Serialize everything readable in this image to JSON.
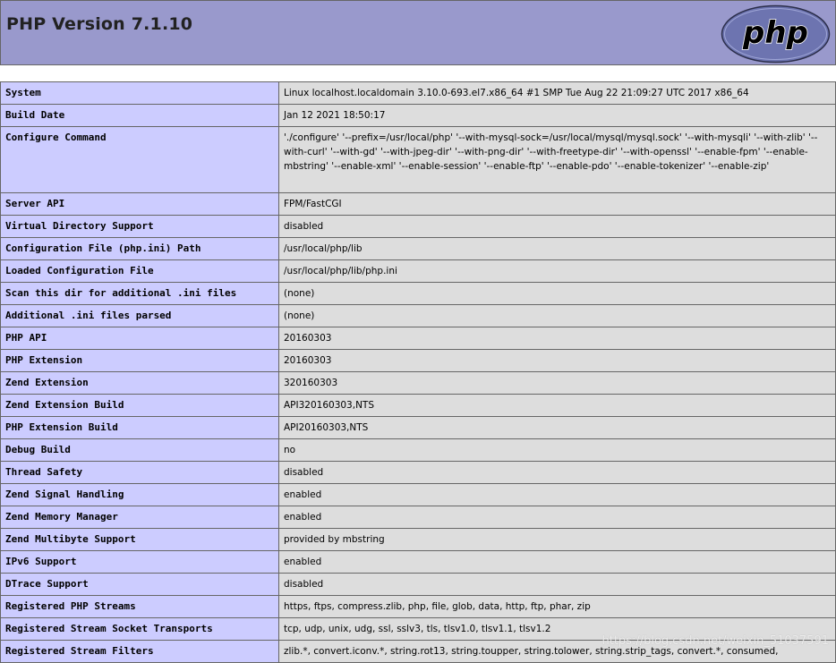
{
  "header": {
    "title": "PHP Version 7.1.10",
    "logo_text": "php"
  },
  "rows": [
    {
      "key": "System",
      "value": "Linux localhost.localdomain 3.10.0-693.el7.x86_64 #1 SMP Tue Aug 22 21:09:27 UTC 2017 x86_64"
    },
    {
      "key": "Build Date",
      "value": "Jan 12 2021 18:50:17"
    },
    {
      "key": "Configure Command",
      "value": "'./configure' '--prefix=/usr/local/php' '--with-mysql-sock=/usr/local/mysql/mysql.sock' '--with-mysqli' '--with-zlib' '--with-curl' '--with-gd' '--with-jpeg-dir' '--with-png-dir' '--with-freetype-dir' '--with-openssl' '--enable-fpm' '--enable-mbstring' '--enable-xml' '--enable-session' '--enable-ftp' '--enable-pdo' '--enable-tokenizer' '--enable-zip'"
    },
    {
      "key": "Server API",
      "value": "FPM/FastCGI"
    },
    {
      "key": "Virtual Directory Support",
      "value": "disabled"
    },
    {
      "key": "Configuration File (php.ini) Path",
      "value": "/usr/local/php/lib"
    },
    {
      "key": "Loaded Configuration File",
      "value": "/usr/local/php/lib/php.ini"
    },
    {
      "key": "Scan this dir for additional .ini files",
      "value": "(none)"
    },
    {
      "key": "Additional .ini files parsed",
      "value": "(none)"
    },
    {
      "key": "PHP API",
      "value": "20160303"
    },
    {
      "key": "PHP Extension",
      "value": "20160303"
    },
    {
      "key": "Zend Extension",
      "value": "320160303"
    },
    {
      "key": "Zend Extension Build",
      "value": "API320160303,NTS"
    },
    {
      "key": "PHP Extension Build",
      "value": "API20160303,NTS"
    },
    {
      "key": "Debug Build",
      "value": "no"
    },
    {
      "key": "Thread Safety",
      "value": "disabled"
    },
    {
      "key": "Zend Signal Handling",
      "value": "enabled"
    },
    {
      "key": "Zend Memory Manager",
      "value": "enabled"
    },
    {
      "key": "Zend Multibyte Support",
      "value": "provided by mbstring"
    },
    {
      "key": "IPv6 Support",
      "value": "enabled"
    },
    {
      "key": "DTrace Support",
      "value": "disabled"
    },
    {
      "key": "Registered PHP Streams",
      "value": "https, ftps, compress.zlib, php, file, glob, data, http, ftp, phar, zip"
    },
    {
      "key": "Registered Stream Socket Transports",
      "value": "tcp, udp, unix, udg, ssl, sslv3, tls, tlsv1.0, tlsv1.1, tlsv1.2"
    },
    {
      "key": "Registered Stream Filters",
      "value": "zlib.*, convert.iconv.*, string.rot13, string.toupper, string.tolower, string.strip_tags, convert.*, consumed,"
    }
  ],
  "watermark": "https://blog.csdn.net/weixin_51037591",
  "colors": {
    "header_bg": "#9999cc",
    "key_bg": "#ccccff",
    "value_bg": "#dddddd",
    "border": "#666666",
    "logo_fill": "#6d74b0"
  }
}
